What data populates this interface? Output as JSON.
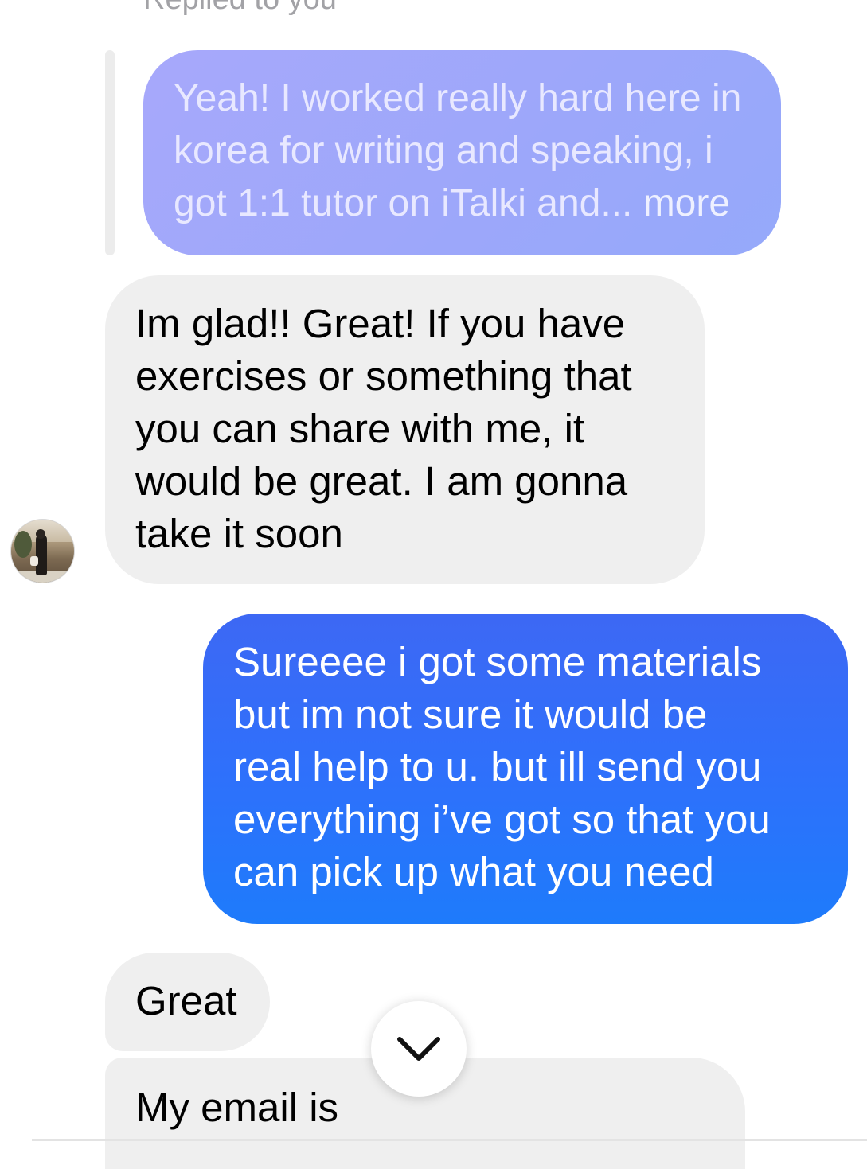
{
  "thread": {
    "reply_label": "Replied to you",
    "quoted_message": {
      "text": "Yeah! I worked really hard here in\nkorea for writing and speaking, i\ngot 1:1 tutor on iTalki and...",
      "more_label": " more"
    },
    "messages": [
      {
        "sender": "them",
        "text": "Im glad!! Great! If you have\nexercises or something that\nyou can share with me, it\nwould be great. I am gonna\ntake it soon"
      },
      {
        "sender": "me",
        "text": "Sureeee i got some materials\nbut  im not sure it would be\nreal help to u. but ill send you\neverything i’ve got so that you\ncan pick up what you need"
      },
      {
        "sender": "them",
        "text": "Great"
      },
      {
        "sender": "them",
        "text": "My email is"
      }
    ]
  },
  "icons": {
    "scroll_down": "chevron-down-icon",
    "avatar": "contact-avatar"
  },
  "colors": {
    "sent_bubble": "#2f70fb",
    "quoted_bubble": "#a2a8fb",
    "received_bubble": "#efefef"
  }
}
